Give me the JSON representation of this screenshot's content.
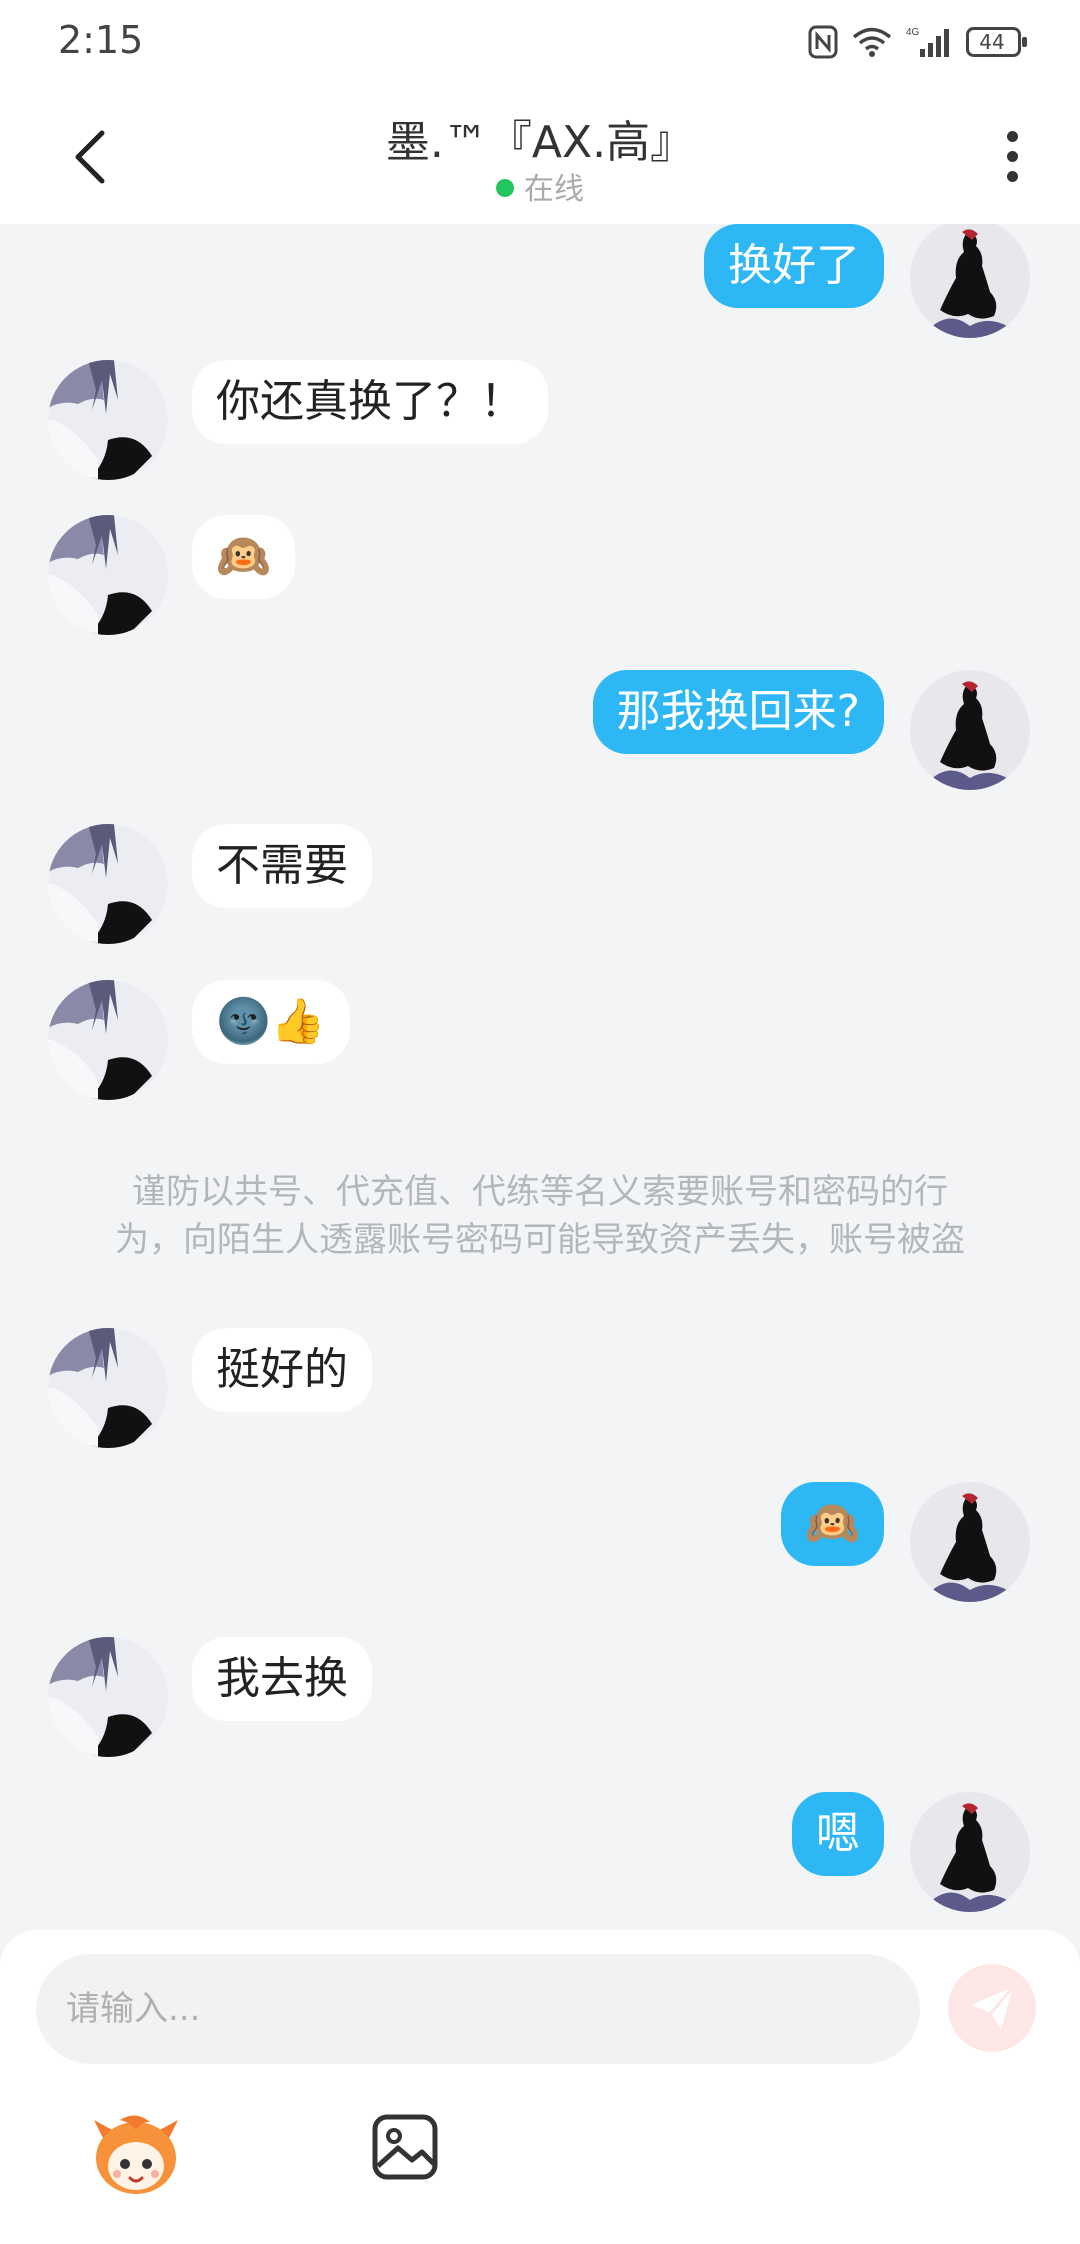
{
  "status_bar": {
    "time": "2:15",
    "battery": "44",
    "network": "4G"
  },
  "header": {
    "title": "墨.™『AX.高』",
    "status": "在线"
  },
  "messages": [
    {
      "side": "out",
      "text": "换好了"
    },
    {
      "side": "in",
      "text": "你还真换了？！"
    },
    {
      "side": "in",
      "text": "🙉"
    },
    {
      "side": "out",
      "text": "那我换回来?"
    },
    {
      "side": "in",
      "text": "不需要"
    },
    {
      "side": "in",
      "text": "🌚👍"
    },
    {
      "side": "in",
      "text": "挺好的"
    },
    {
      "side": "out",
      "text": "🙉"
    },
    {
      "side": "in",
      "text": "我去换"
    },
    {
      "side": "out",
      "text": "嗯"
    }
  ],
  "notice": {
    "line1": "谨防以共号、代充值、代练等名义索要账号和密码的行",
    "line2": "为，向陌生人透露账号密码可能导致资产丢失，账号被盗"
  },
  "composer": {
    "placeholder": "请输入..."
  },
  "colors": {
    "accent": "#2db7f5",
    "background": "#f3f4f6",
    "online": "#22c55e",
    "send_disabled": "#fde6e6"
  },
  "icons": {
    "back": "back-arrow-icon",
    "more": "more-vertical-icon",
    "send": "send-icon",
    "mascot": "mascot-sticker-icon",
    "image": "image-icon"
  }
}
